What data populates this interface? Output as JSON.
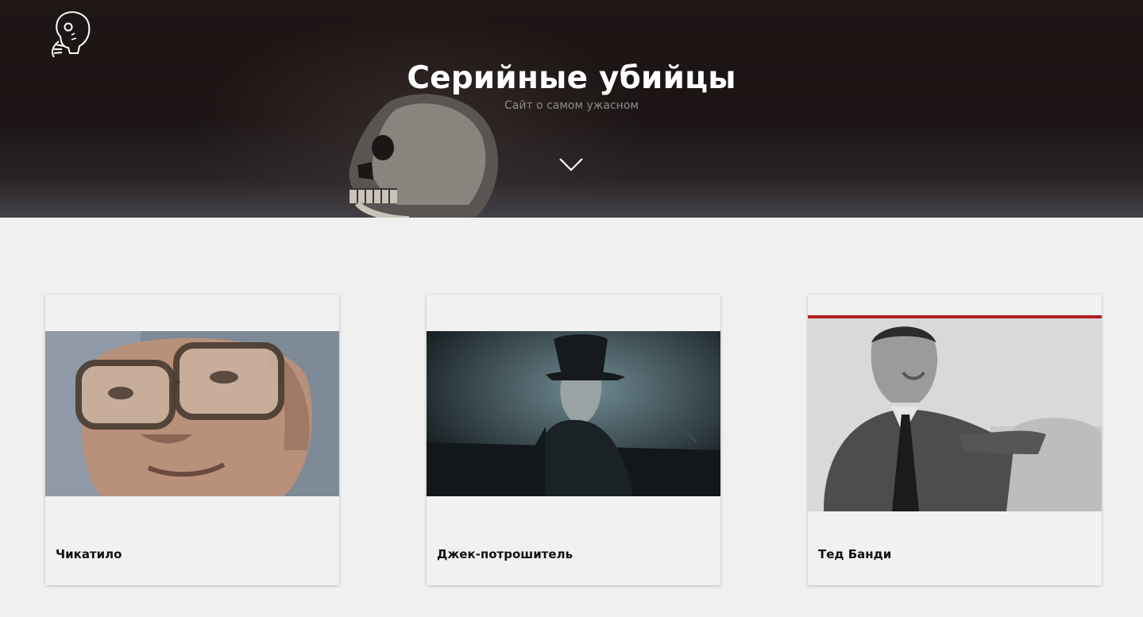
{
  "header": {
    "logo_icon": "skull-hand-icon",
    "title": "Серийные убийцы",
    "subtitle": "Сайт о самом ужасном",
    "scroll_icon": "chevron-down-icon"
  },
  "cards": [
    {
      "name": "Чикатило",
      "photo": "portrait-with-glasses-photo"
    },
    {
      "name": "Джек-потрошитель",
      "photo": "top-hat-figure-photo"
    },
    {
      "name": "Тед Банди",
      "photo": "black-and-white-portrait-photo"
    }
  ],
  "colors": {
    "hero_background": "#1c1414",
    "page_background": "#f0f0f0",
    "card_background": "#f1f1f1",
    "title_color": "#ffffff",
    "subtitle_color": "#8e8a8a",
    "card_text_color": "#111111"
  }
}
